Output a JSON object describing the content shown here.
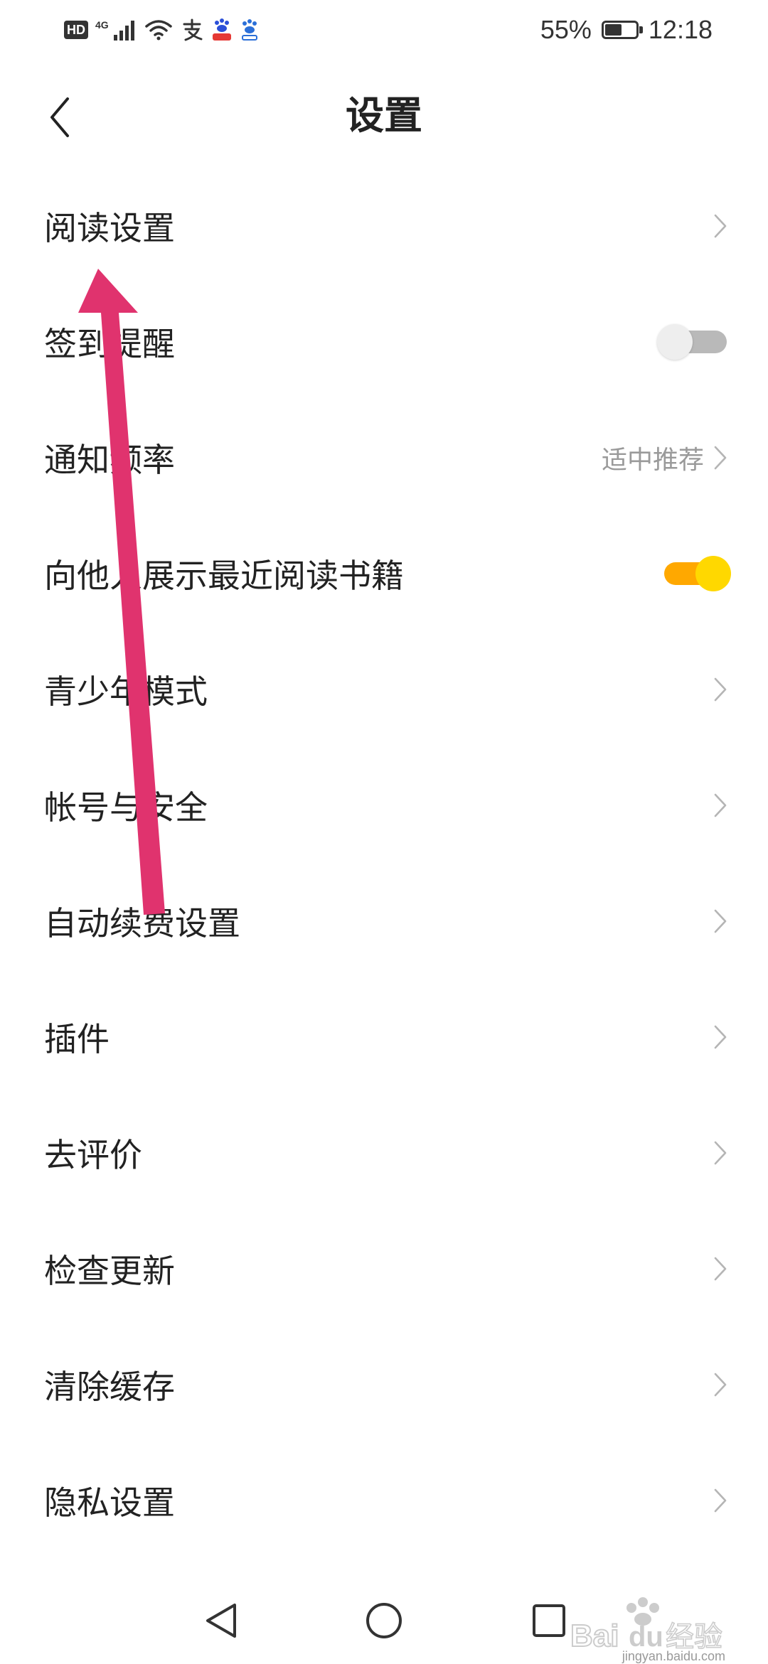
{
  "status_bar": {
    "hd": "HD",
    "network": "4G",
    "alipay_icon": "alipay-icon",
    "battery_percent": "55%",
    "battery_level": 0.55,
    "time": "12:18"
  },
  "header": {
    "title": "设置",
    "back_icon": "back-arrow-icon"
  },
  "settings": [
    {
      "label": "阅读设置",
      "control": "chevron"
    },
    {
      "label": "签到提醒",
      "control": "toggle",
      "on": false
    },
    {
      "label": "通知频率",
      "control": "chevron",
      "value": "适中推荐"
    },
    {
      "label": "向他人展示最近阅读书籍",
      "control": "toggle",
      "on": true
    },
    {
      "label": "青少年模式",
      "control": "chevron"
    },
    {
      "label": "帐号与安全",
      "control": "chevron"
    },
    {
      "label": "自动续费设置",
      "control": "chevron"
    },
    {
      "label": "插件",
      "control": "chevron"
    },
    {
      "label": "去评价",
      "control": "chevron"
    },
    {
      "label": "检查更新",
      "control": "chevron"
    },
    {
      "label": "清除缓存",
      "control": "chevron"
    },
    {
      "label": "隐私设置",
      "control": "chevron"
    }
  ],
  "nav_bar": {
    "back": "triangle-back-icon",
    "home": "circle-home-icon",
    "recent": "square-recent-icon"
  },
  "watermark": {
    "brand": "Bai",
    "brand_suffix": "du",
    "brand_cn": "经验",
    "site": "jingyan.baidu.com"
  },
  "colors": {
    "annotation_arrow": "#e0336e",
    "toggle_on_track": "#ffa800",
    "toggle_on_knob": "#ffd800",
    "toggle_off_track": "#b9b9b9",
    "chevron": "#b5b5b5"
  }
}
